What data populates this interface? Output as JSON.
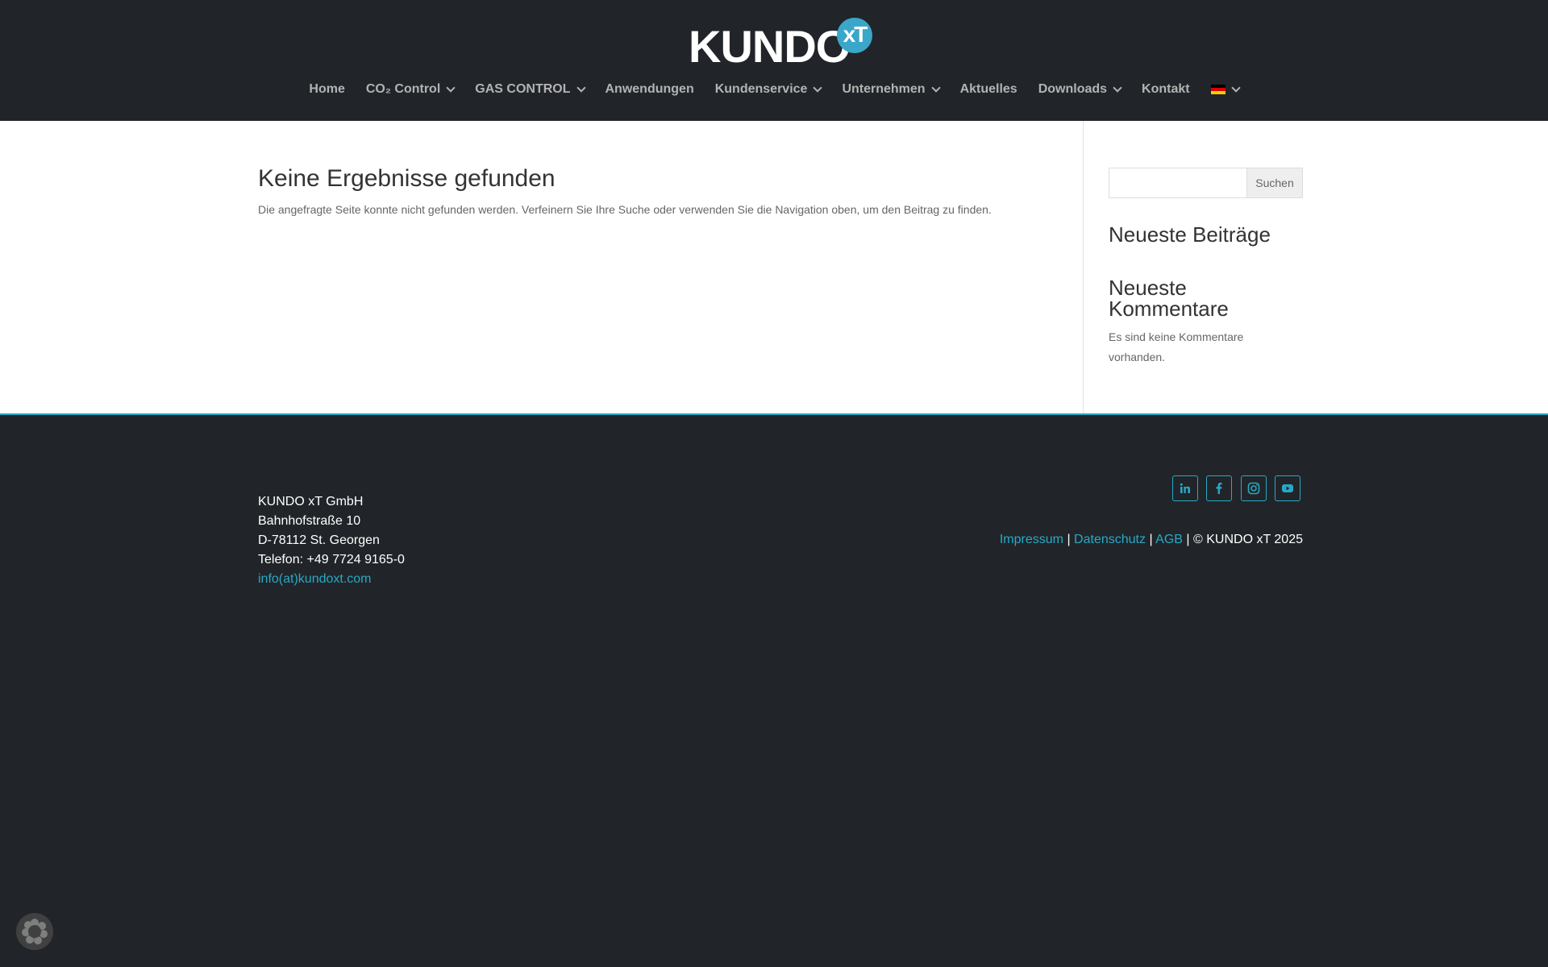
{
  "header": {
    "logo_text": "KUNDO",
    "logo_badge": "xT",
    "nav": [
      {
        "label": "Home",
        "dropdown": false
      },
      {
        "label": "CO₂ Control",
        "dropdown": true
      },
      {
        "label": "GAS CONTROL",
        "dropdown": true
      },
      {
        "label": "Anwendungen",
        "dropdown": false
      },
      {
        "label": "Kundenservice",
        "dropdown": true
      },
      {
        "label": "Unternehmen",
        "dropdown": true
      },
      {
        "label": "Aktuelles",
        "dropdown": false
      },
      {
        "label": "Downloads",
        "dropdown": true
      },
      {
        "label": "Kontakt",
        "dropdown": false
      }
    ],
    "language_flag": "german-flag-icon"
  },
  "main": {
    "title": "Keine Ergebnisse gefunden",
    "message": "Die angefragte Seite konnte nicht gefunden werden. Verfeinern Sie Ihre Suche oder verwenden Sie die Navigation oben, um den Beitrag zu finden."
  },
  "sidebar": {
    "search_value": "",
    "search_button": "Suchen",
    "recent_posts_title": "Neueste Beiträge",
    "recent_comments_title": "Neueste Kommentare",
    "recent_comments_text": "Es sind keine Kommentare vorhanden."
  },
  "footer": {
    "company": "KUNDO xT GmbH",
    "street": "Bahnhofstraße 10",
    "city": "D-78112 St. Georgen",
    "phone": "Telefon: +49 7724 9165-0",
    "email": "info(at)kundoxt.com",
    "social": [
      "linkedin-icon",
      "facebook-icon",
      "instagram-icon",
      "youtube-icon"
    ],
    "legal": {
      "impressum": "Impressum",
      "datenschutz": "Datenschutz",
      "agb": "AGB",
      "separator": "|",
      "copyright": "© KUNDO xT 2025"
    }
  },
  "colors": {
    "dark_bg": "#212529",
    "accent": "#27a9c6",
    "nav_text": "#b3b3b3"
  }
}
